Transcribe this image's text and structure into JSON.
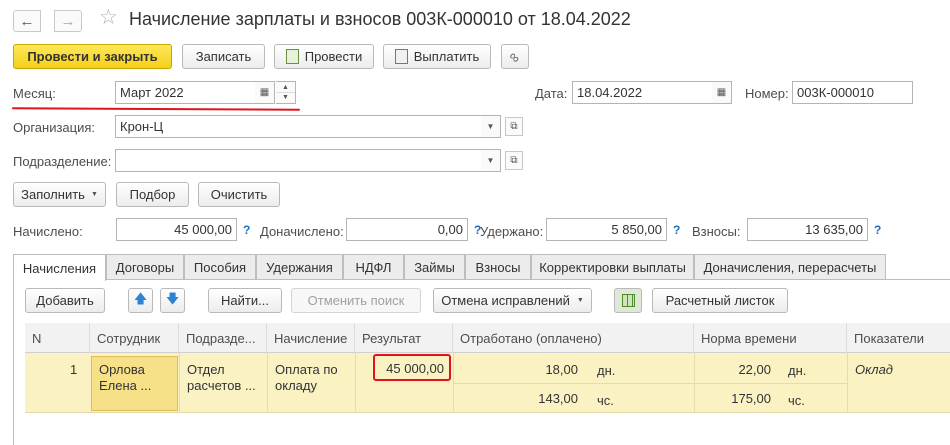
{
  "window": {
    "title": "Начисление зарплаты и взносов 003К-000010 от 18.04.2022"
  },
  "toolbar": {
    "post_close": "Провести и закрыть",
    "save": "Записать",
    "post": "Провести",
    "pay": "Выплатить"
  },
  "header": {
    "month_label": "Месяц:",
    "month_value": "Март 2022",
    "date_label": "Дата:",
    "date_value": "18.04.2022",
    "number_label": "Номер:",
    "number_value": "003К-000010",
    "org_label": "Организация:",
    "org_value": "Крон-Ц",
    "dept_label": "Подразделение:",
    "dept_value": ""
  },
  "actions": {
    "fill": "Заполнить",
    "select": "Подбор",
    "clear": "Очистить"
  },
  "totals": {
    "accrued_label": "Начислено:",
    "accrued_value": "45 000,00",
    "extra_label": "Доначислено:",
    "extra_value": "0,00",
    "withheld_label": "Удержано:",
    "withheld_value": "5 850,00",
    "contrib_label": "Взносы:",
    "contrib_value": "13 635,00",
    "help_mark": "?"
  },
  "tabs": [
    "Начисления",
    "Договоры",
    "Пособия",
    "Удержания",
    "НДФЛ",
    "Займы",
    "Взносы",
    "Корректировки выплаты",
    "Доначисления, перерасчеты"
  ],
  "table_toolbar": {
    "add": "Добавить",
    "find": "Найти...",
    "cancel_search": "Отменить поиск",
    "cancel_fix": "Отмена исправлений",
    "payslip": "Расчетный листок"
  },
  "table": {
    "columns": [
      "N",
      "Сотрудник",
      "Подразде...",
      "Начисление",
      "Результат",
      "Отработано (оплачено)",
      "Норма времени",
      "Показатели"
    ],
    "row": {
      "n": "1",
      "employee_line1": "Орлова",
      "employee_line2": "Елена ...",
      "dept_line1": "Отдел",
      "dept_line2": "расчетов ...",
      "accrual_line1": "Оплата по",
      "accrual_line2": "окладу",
      "result": "45 000,00",
      "worked_days": "18,00",
      "worked_days_unit": "дн.",
      "worked_hours": "143,00",
      "worked_hours_unit": "чс.",
      "norm_days": "22,00",
      "norm_days_unit": "дн.",
      "norm_hours": "175,00",
      "norm_hours_unit": "чс.",
      "indicator": "Оклад"
    }
  },
  "colors": {
    "primary_button": "#f5d019",
    "row_highlight": "#fbf2c4",
    "selected_cell": "#f6e189",
    "red_annotation": "#e0141e",
    "help_blue": "#1a6fc4",
    "arrow_blue": "#2f83d6"
  }
}
